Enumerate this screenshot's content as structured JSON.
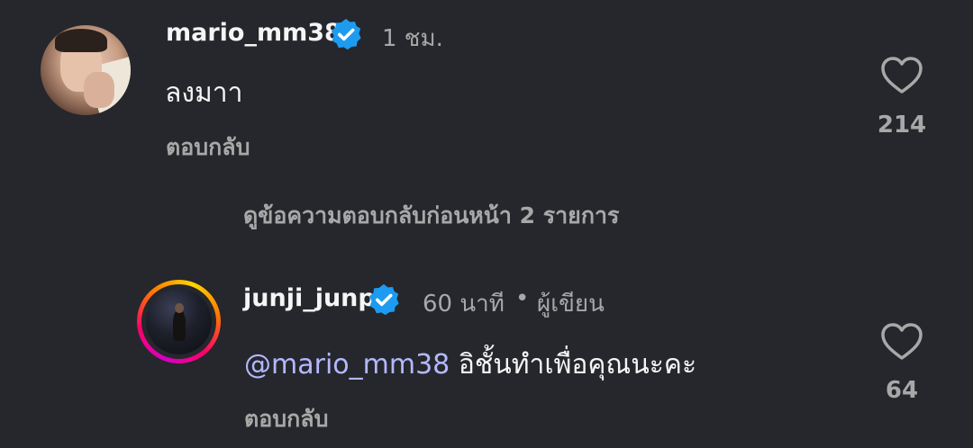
{
  "comment": {
    "username": "mario_mm38",
    "time": "1 ชม.",
    "text": "ลงมาา",
    "reply_label": "ตอบกลับ",
    "likes": "214",
    "verified": true
  },
  "view_previous_replies": "ดูข้อความตอบกลับก่อนหน้า 2 รายการ",
  "reply": {
    "username": "junji_junp",
    "time": "60 นาที",
    "separator": "•",
    "author_label": "ผู้เขียน",
    "mention": "@mario_mm38",
    "text": "อิชั้นทำเพื่อคุณนะคะ",
    "reply_label": "ตอบกลับ",
    "likes": "64",
    "verified": true
  },
  "colors": {
    "background": "#25272c",
    "verified_badge": "#1d9bf0",
    "mention": "#b3b8ff",
    "muted_text": "#a8a8a8"
  }
}
